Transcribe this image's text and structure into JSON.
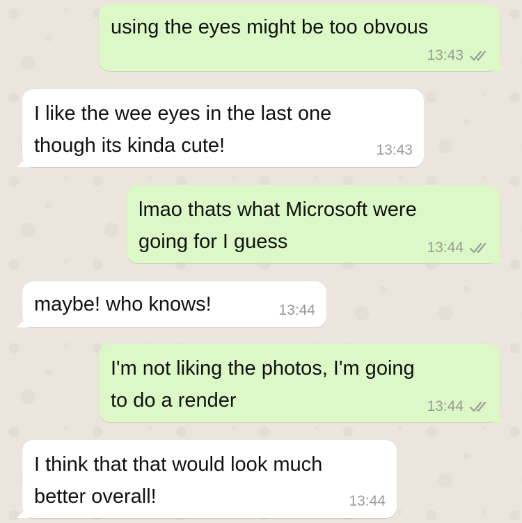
{
  "colors": {
    "outgoing_bubble": "#dcf8c6",
    "incoming_bubble": "#ffffff",
    "chat_background": "#ece5dd",
    "timestamp": "#9a9a9a",
    "read_tick": "#9a9a9a"
  },
  "messages": [
    {
      "direction": "out",
      "lines": [
        "using the eyes might be too obvous"
      ],
      "time": "13:43",
      "status_icon": "double-check-icon"
    },
    {
      "direction": "in",
      "lines": [
        "I like the wee eyes in the last one",
        "though its kinda cute!"
      ],
      "time": "13:43"
    },
    {
      "direction": "out",
      "lines": [
        "lmao thats what Microsoft were",
        "going for I guess"
      ],
      "time": "13:44",
      "status_icon": "double-check-icon"
    },
    {
      "direction": "in",
      "lines": [
        "maybe! who knows!"
      ],
      "time": "13:44"
    },
    {
      "direction": "out",
      "lines": [
        "I'm not liking the photos, I'm going",
        "to do a render"
      ],
      "time": "13:44",
      "status_icon": "double-check-icon"
    },
    {
      "direction": "in",
      "lines": [
        "I think that that would look much",
        "better overall!"
      ],
      "time": "13:44"
    }
  ]
}
